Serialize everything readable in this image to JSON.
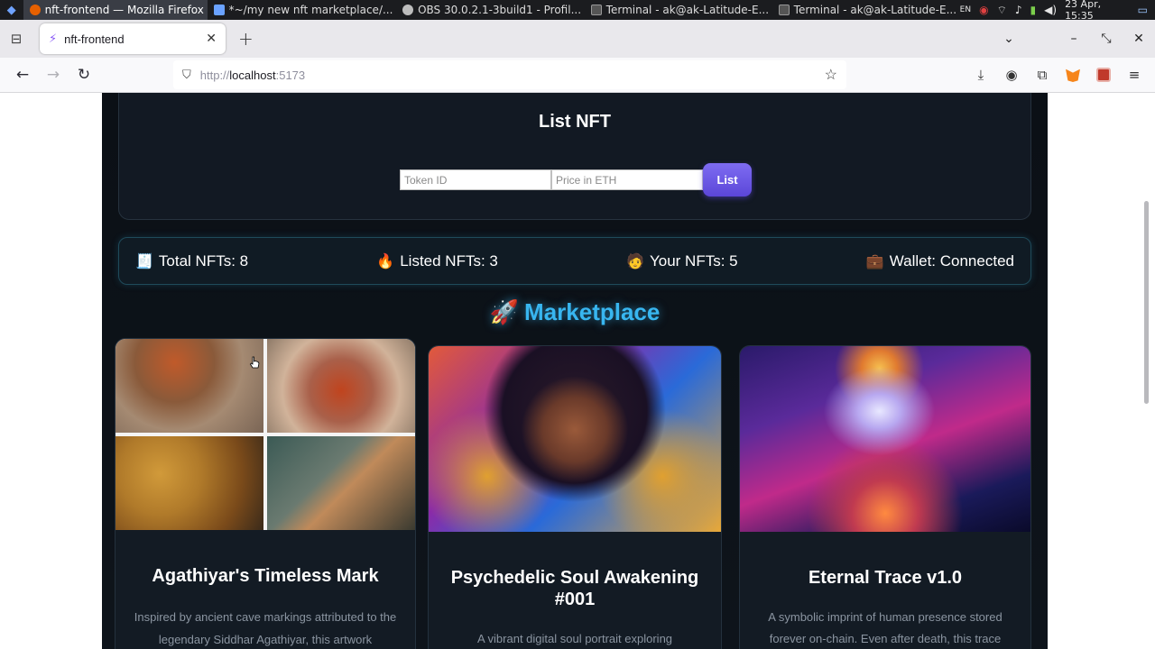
{
  "taskbar": {
    "tasks": [
      {
        "label": "nft-frontend — Mozilla Firefox",
        "color": "#e66000"
      },
      {
        "label": "*~/my new nft marketplace/...",
        "color": "#6aa2ff"
      },
      {
        "label": "OBS 30.0.2.1-3build1 - Profil...",
        "color": "#bdbdbd"
      },
      {
        "label": "Terminal - ak@ak-Latitude-E...",
        "color": "#9a9a9a"
      },
      {
        "label": "Terminal - ak@ak-Latitude-E...",
        "color": "#9a9a9a"
      }
    ],
    "lang": "EN",
    "clock": "23 Apr, 15:35"
  },
  "browser": {
    "tab_title": "nft-frontend",
    "url_proto": "http://",
    "url_host": "localhost",
    "url_port": ":5173"
  },
  "app": {
    "list_title": "List NFT",
    "token_placeholder": "Token ID",
    "price_placeholder": "Price in ETH",
    "list_button": "List",
    "stats": [
      {
        "emoji": "🧾",
        "label": "Total NFTs: 8"
      },
      {
        "emoji": "🔥",
        "label": "Listed NFTs: 3"
      },
      {
        "emoji": "🧑",
        "label": "Your NFTs: 5"
      },
      {
        "emoji": "💼",
        "label": "Wallet: Connected"
      }
    ],
    "marketplace_emoji": "🚀",
    "marketplace_title": "Marketplace",
    "cards": [
      {
        "title": "Agathiyar's Timeless Mark",
        "desc_1": "Inspired by ancient cave markings attributed to the",
        "desc_2": "legendary Siddhar Agathiyar, this artwork"
      },
      {
        "title": "Psychedelic Soul Awakening #001",
        "desc_1": "A vibrant digital soul portrait exploring",
        "desc_2": ""
      },
      {
        "title": "Eternal Trace v1.0",
        "desc_1": "A symbolic imprint of human presence stored",
        "desc_2": "forever on-chain. Even after death, this trace"
      }
    ]
  }
}
